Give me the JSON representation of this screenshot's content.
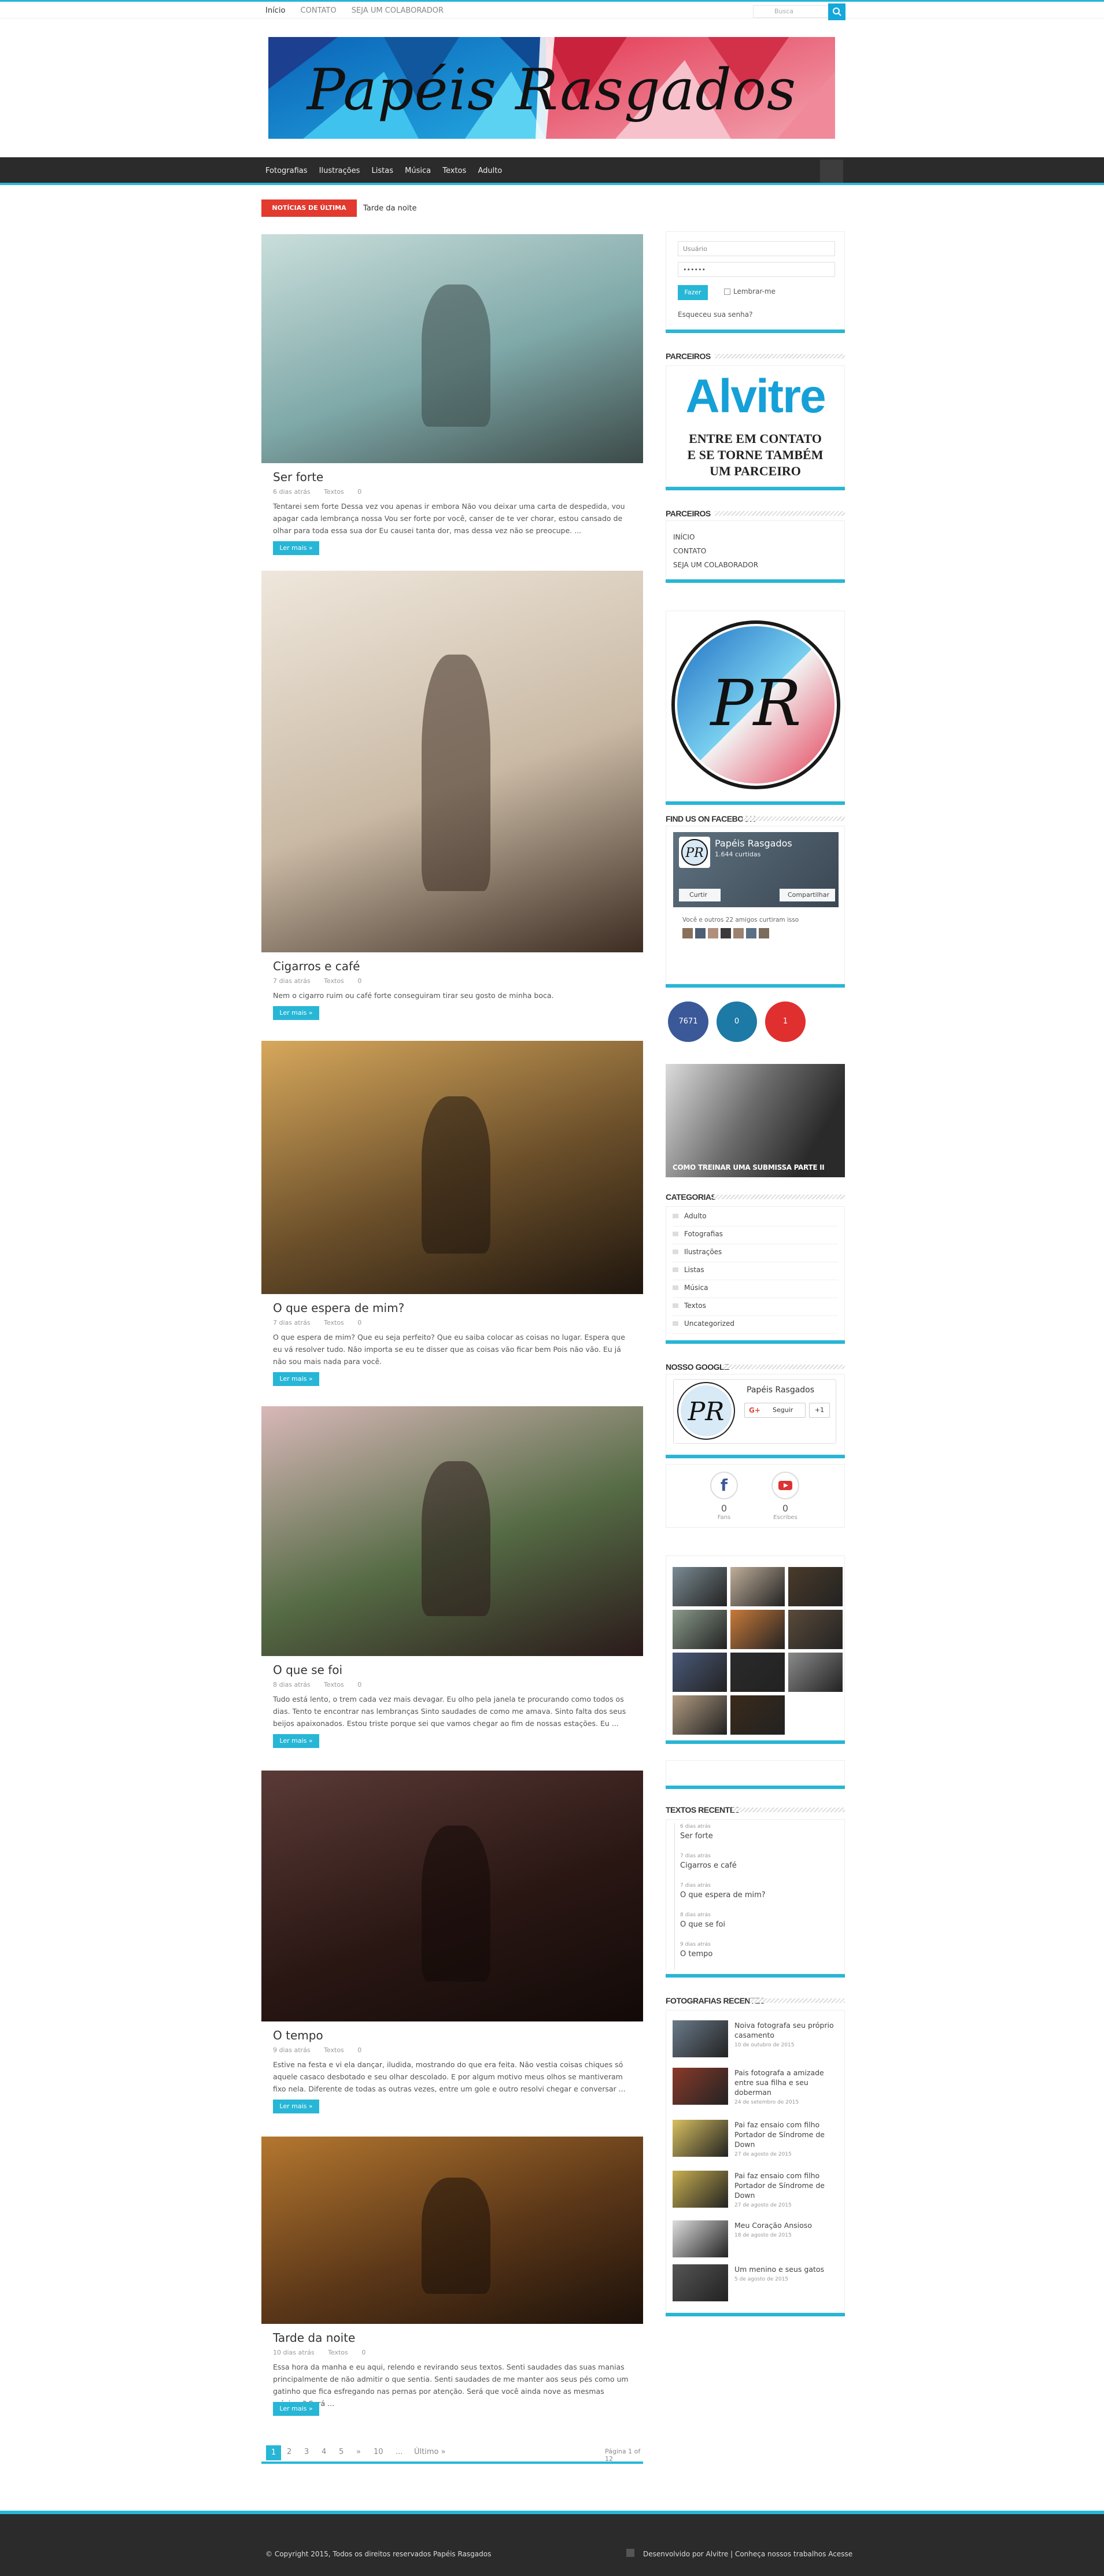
{
  "topbar": {
    "links": [
      "Início",
      "CONTATO",
      "SEJA UM COLABORADOR"
    ],
    "search_placeholder": "Busca"
  },
  "banner": {
    "title": "Papéis Rasgados"
  },
  "nav": {
    "items": [
      "Fotografias",
      "Ilustrações",
      "Listas",
      "Música",
      "Textos",
      "Adulto"
    ]
  },
  "breaking": {
    "label": "NOTÍCIAS DE ÚLTIMA HORA",
    "text": "Tarde da noite"
  },
  "posts": [
    {
      "title": "Ser forte",
      "date": "6 dias atrás",
      "category": "Textos",
      "comments": "0",
      "excerpt": "Tentarei sem forte Dessa vez vou apenas ir embora Não vou deixar uma carta de despedida, vou apagar cada lembrança nossa Vou ser forte por você, canser de te ver chorar, estou cansado de olhar para toda essa sua dor Eu causei tanta dor, mas dessa vez não se preocupe. ...",
      "more": "Ler mais »",
      "img_colors": [
        "#c9dedb",
        "#7fa8a8",
        "#3b4a48"
      ]
    },
    {
      "title": "Cigarros e café",
      "date": "7 dias atrás",
      "category": "Textos",
      "comments": "0",
      "excerpt": "Nem o cigarro ruim ou café forte conseguiram tirar seu gosto de minha boca.",
      "more": "Ler mais »",
      "img_colors": [
        "#efe7dc",
        "#c9b9a4",
        "#3c2c22"
      ]
    },
    {
      "title": "O que espera de mim?",
      "date": "7 dias atrás",
      "category": "Textos",
      "comments": "0",
      "excerpt": "O que espera de mim? Que eu seja perfeito? Que eu saiba colocar as coisas no lugar. Espera que eu vá resolver tudo. Não importa se eu te disser que as coisas vão ficar bem Pois não vão. Eu já não sou mais nada para você.",
      "more": "Ler mais »",
      "img_colors": [
        "#d7a85c",
        "#6b4f2a",
        "#1f160e"
      ]
    },
    {
      "title": "O que se foi",
      "date": "8 dias atrás",
      "category": "Textos",
      "comments": "0",
      "excerpt": "Tudo está lento, o trem cada vez mais devagar. Eu olho pela janela te procurando como todos os dias. Tento te encontrar nas lembranças Sinto saudades de como me amava. Sinto falta dos seus beijos apaixonados. Estou triste porque sei que vamos chegar ao fim de nossas estações. Eu ...",
      "more": "Ler mais »",
      "img_colors": [
        "#d8b8b8",
        "#556b45",
        "#2a1a1a"
      ]
    },
    {
      "title": "O tempo",
      "date": "9 dias atrás",
      "category": "Textos",
      "comments": "0",
      "excerpt": "Estive na festa e vi ela dançar, iludida, mostrando do que era feita. Não vestia coisas chiques só aquele casaco desbotado e seu olhar descolado. E por algum motivo meus olhos se mantiveram fixo nela. Diferente de todas as outras vezes, entre um gole e outro resolvi chegar e conversar ...",
      "more": "Ler mais »",
      "img_colors": [
        "#5a3a36",
        "#2a1714",
        "#120a08"
      ]
    },
    {
      "title": "Tarde da noite",
      "date": "10 dias atrás",
      "category": "Textos",
      "comments": "0",
      "excerpt": "Essa hora da manha e eu aqui, relendo e revirando seus textos. Senti saudades das suas manias principalmente de não admitir o que sentia. Senti saudades de me manter aos seus pés como um gatinho que fica esfregando nas pernas por atenção. Será que você ainda nove as mesmas músicas? Será ...",
      "more": "Ler mais »",
      "img_colors": [
        "#b4772f",
        "#5b3718",
        "#1c110a"
      ]
    }
  ],
  "pagination": {
    "pages": [
      "1",
      "2",
      "3",
      "4",
      "5",
      "»",
      "10",
      "...",
      "Último »"
    ],
    "page_info": "Página 1 of 12"
  },
  "sidebar": {
    "login": {
      "user_placeholder": "Usuário",
      "password_value": "••••••",
      "button": "Fazer",
      "remember": "Lembrar-me",
      "forgot": "Esqueceu sua senha?"
    },
    "partners_title": "PARCEIROS",
    "partner_ad": {
      "brand": "Alvitre",
      "line1": "ENTRE EM CONTATO",
      "line2": "E SE TORNE TAMBÉM",
      "line3": "UM PARCEIRO"
    },
    "partners2_title": "PARCEIROS",
    "partners2_links": [
      "INÍCIO",
      "CONTATO",
      "SEJA UM COLABORADOR"
    ],
    "logo_letters": "PR",
    "facebook_title": "FIND US ON FACEBOOK",
    "facebook": {
      "page": "Papéis Rasgados",
      "likes": "1.644 curtidas",
      "like_btn": "Curtir",
      "share_btn": "Compartilhar",
      "friends": "Você e outros 22 amigos curtiram isso"
    },
    "social_counts": [
      {
        "value": "7671",
        "color": "#3b5998"
      },
      {
        "value": "0",
        "color": "#1d79a5"
      },
      {
        "value": "1",
        "color": "#e02f2f"
      }
    ],
    "featured_caption": "COMO TREINAR UMA SUBMISSA PARTE II",
    "categories_title": "CATEGORIAS",
    "categories": [
      "Adulto",
      "Fotografias",
      "Ilustrações",
      "Listas",
      "Música",
      "Textos",
      "Uncategorized"
    ],
    "google_title": "NOSSO GOOGLE+",
    "google": {
      "page": "Papéis Rasgados",
      "follow": "Seguir",
      "plus": "+1"
    },
    "social2": [
      {
        "count": "0",
        "label": "Fans"
      },
      {
        "count": "0",
        "label": "Escribes"
      }
    ],
    "recent_texts_title": "TEXTOS RECENTES",
    "recent_texts": [
      {
        "date": "6 dias atrás",
        "title": "Ser forte"
      },
      {
        "date": "7 dias atrás",
        "title": "Cigarros e café"
      },
      {
        "date": "7 dias atrás",
        "title": "O que espera de mim?"
      },
      {
        "date": "8 dias atrás",
        "title": "O que se foi"
      },
      {
        "date": "9 dias atrás",
        "title": "O tempo"
      }
    ],
    "recent_photos_title": "FOTOGRAFIAS RECENTES",
    "recent_photos": [
      {
        "title": "Noiva fotografa seu próprio casamento",
        "date": "10 de outubro de 2015"
      },
      {
        "title": "Pais fotografa a amizade entre sua filha e seu doberman",
        "date": "24 de setembro de 2015"
      },
      {
        "title": "Pai faz ensaio com filho Portador de Síndrome de Down",
        "date": "27 de agosto de 2015"
      },
      {
        "title": "Pai faz ensaio com filho Portador de Síndrome de Down",
        "date": "27 de agosto de 2015"
      },
      {
        "title": "Meu Coração Ansioso",
        "date": "18 de agosto de 2015"
      },
      {
        "title": "Um menino e seus gatos",
        "date": "5 de agosto de 2015"
      }
    ]
  },
  "footer": {
    "copyright": "© Copyright 2015, Todos os direitos reservados Papéis Rasgados",
    "credits": "Desenvolvido por Alvitre | Conheça nossos trabalhos Acesse"
  }
}
